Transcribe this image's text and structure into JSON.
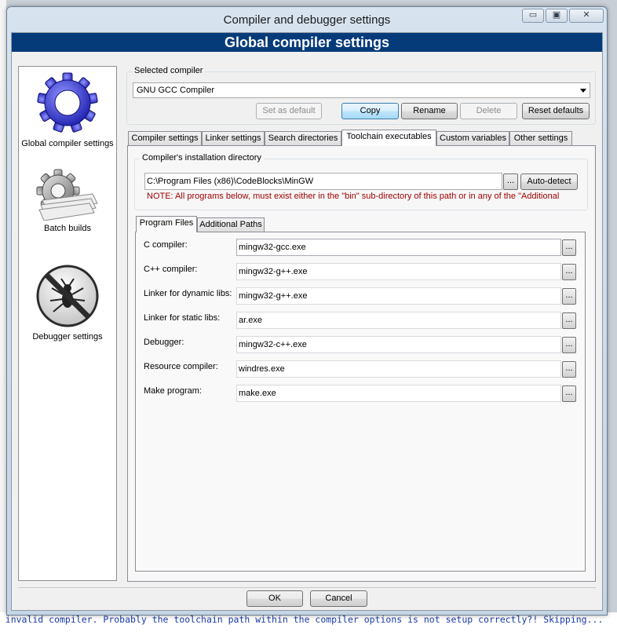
{
  "window": {
    "title": "Compiler and debugger settings",
    "controls": {
      "minimize": "▭",
      "maximize": "▣",
      "close": "✕"
    }
  },
  "banner": {
    "title": "Global compiler settings"
  },
  "categories": [
    {
      "label": "Global compiler settings",
      "icon": "gear-icon"
    },
    {
      "label": "Batch builds",
      "icon": "batch-gears-icon"
    },
    {
      "label": "Debugger settings",
      "icon": "no-bug-icon"
    }
  ],
  "selected_compiler": {
    "group_label": "Selected compiler",
    "value": "GNU GCC Compiler",
    "buttons": {
      "set_default": "Set as default",
      "copy": "Copy",
      "rename": "Rename",
      "delete": "Delete",
      "reset": "Reset defaults"
    }
  },
  "tabs": [
    "Compiler settings",
    "Linker settings",
    "Search directories",
    "Toolchain executables",
    "Custom variables",
    "Other settings"
  ],
  "installation": {
    "group_label": "Compiler's installation directory",
    "path": "C:\\Program Files (x86)\\CodeBlocks\\MinGW",
    "browse": "...",
    "auto_detect": "Auto-detect",
    "note": "NOTE: All programs below, must exist either in the \"bin\" sub-directory of this path or in any of the \"Additional"
  },
  "subtabs": [
    "Program Files",
    "Additional Paths"
  ],
  "programs": [
    {
      "label": "C compiler:",
      "value": "mingw32-gcc.exe"
    },
    {
      "label": "C++ compiler:",
      "value": "mingw32-g++.exe"
    },
    {
      "label": "Linker for dynamic libs:",
      "value": "mingw32-g++.exe"
    },
    {
      "label": "Linker for static libs:",
      "value": "ar.exe"
    },
    {
      "label": "Debugger:",
      "value": "mingw32-c++.exe"
    },
    {
      "label": "Resource compiler:",
      "value": "windres.exe"
    },
    {
      "label": "Make program:",
      "value": "make.exe"
    }
  ],
  "browse_label": "...",
  "footer": {
    "ok": "OK",
    "cancel": "Cancel"
  },
  "background_log": "an invalid compiler. Probably the toolchain path within the compiler options is not setup correctly?! Skipping..."
}
